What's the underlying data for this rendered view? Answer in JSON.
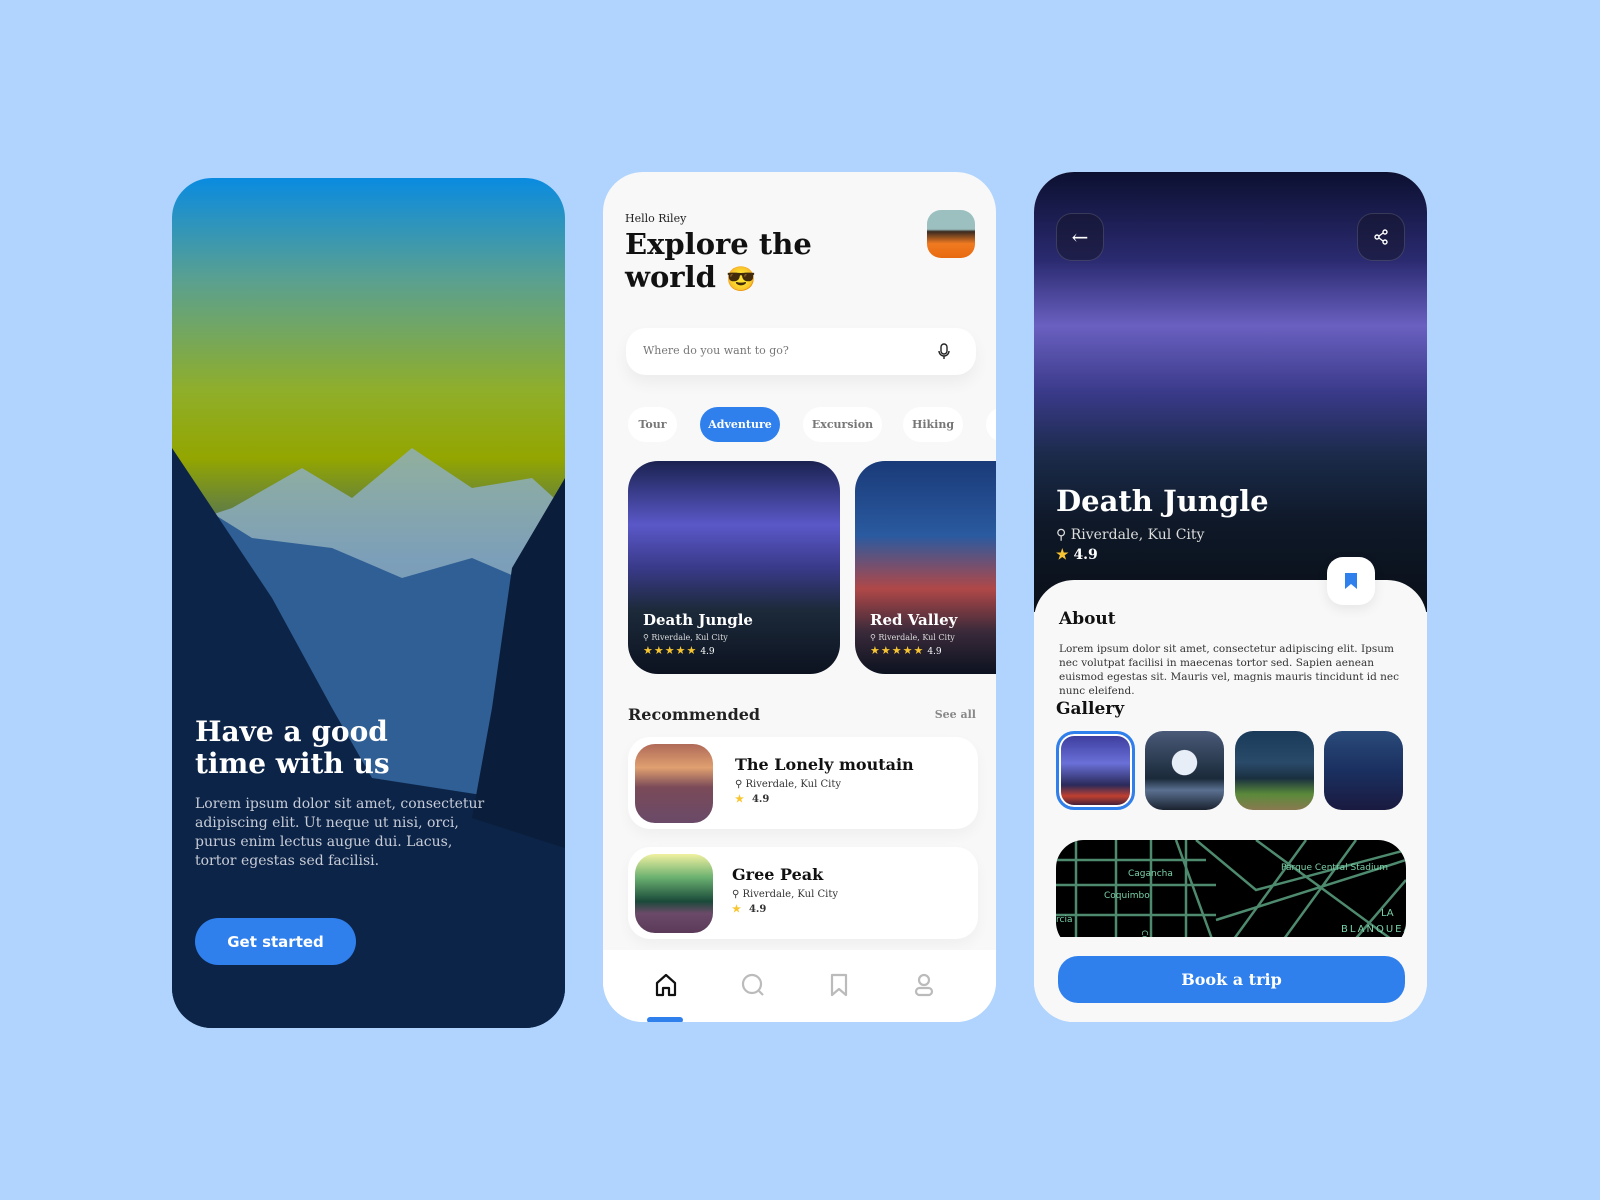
{
  "onboarding": {
    "title_line1": "Have a good",
    "title_line2": "time with us",
    "body": "Lorem ipsum dolor sit amet, consectetur adipiscing elit. Ut neque ut nisi, orci, purus enim lectus augue dui. Lacus, tortor egestas sed facilisi.",
    "cta": "Get started"
  },
  "home": {
    "greeting": "Hello Riley",
    "title_line1": "Explore the",
    "title_line2": "world",
    "emoji": "😎",
    "search_placeholder": "Where do you want to go?",
    "categories": [
      {
        "label": "Tour",
        "active": false
      },
      {
        "label": "Adventure",
        "active": true
      },
      {
        "label": "Excursion",
        "active": false
      },
      {
        "label": "Hiking",
        "active": false
      }
    ],
    "featured": [
      {
        "name": "Death Jungle",
        "location": "Riverdale, Kul City",
        "rating": "4.9"
      },
      {
        "name": "Red Valley",
        "location": "Riverdale, Kul City",
        "rating": "4.9"
      }
    ],
    "recommended_title": "Recommended",
    "see_all": "See all",
    "recommended": [
      {
        "name": "The Lonely moutain",
        "location": "Riverdale, Kul City",
        "rating": "4.9"
      },
      {
        "name": "Gree Peak",
        "location": "Riverdale, Kul City",
        "rating": "4.9"
      }
    ],
    "nav": [
      "home-icon",
      "search-icon",
      "bookmark-icon",
      "profile-icon"
    ],
    "active_nav": "home"
  },
  "detail": {
    "title": "Death Jungle",
    "location": "Riverdale, Kul City",
    "rating": "4.9",
    "about_title": "About",
    "about_text": "Lorem ipsum dolor sit amet, consectetur adipiscing elit. Ipsum nec volutpat facilisi in maecenas tortor sed. Sapien aenean euismod egestas sit. Mauris vel, magnis mauris tincidunt id nec nunc eleifend.",
    "gallery_title": "Gallery",
    "map_labels": [
      "Parque Central Stadium",
      "Cagancha",
      "Coquimbo",
      "rcia",
      "Cufré",
      "LA",
      "BLANQUEA"
    ],
    "cta": "Book a trip"
  },
  "colors": {
    "accent": "#2f80ed",
    "background": "#b0d4fd",
    "star": "#f7c531"
  }
}
